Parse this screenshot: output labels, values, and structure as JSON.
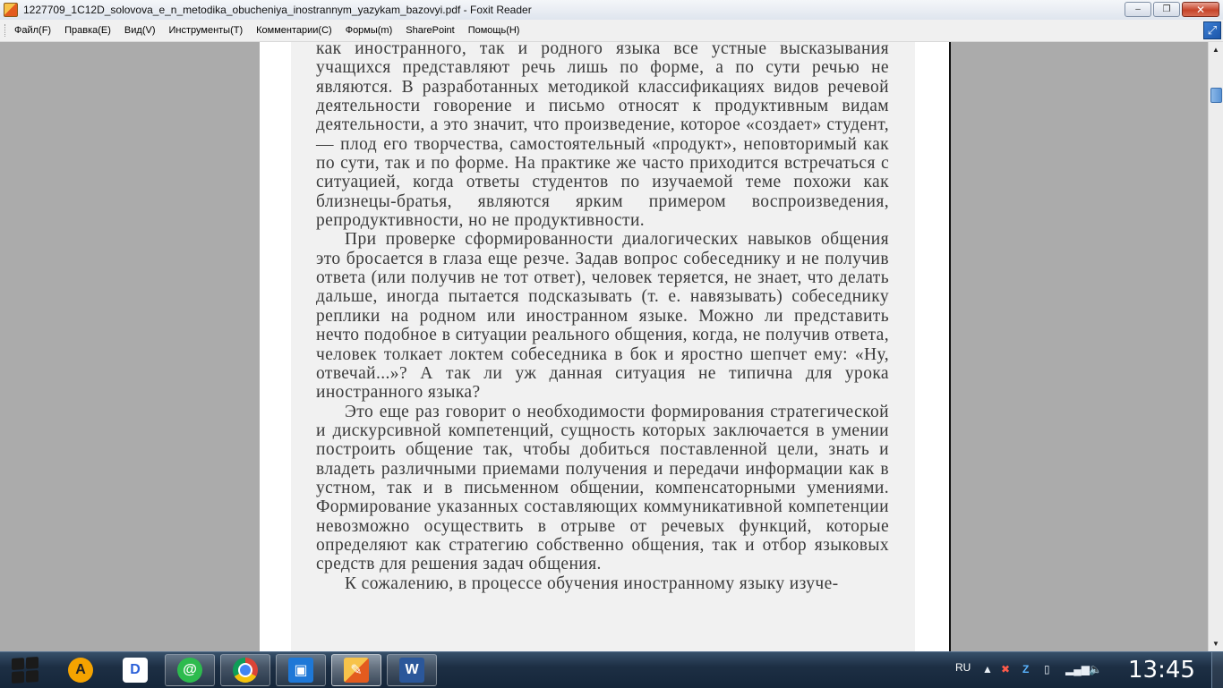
{
  "window": {
    "title": "1227709_1C12D_solovova_e_n_metodika_obucheniya_inostrannym_yazykam_bazovyi.pdf - Foxit Reader",
    "minimize": "‒",
    "maximize": "❐",
    "close": "✕"
  },
  "menu": {
    "items": [
      {
        "label": "Файл(F)"
      },
      {
        "label": "Правка(E)"
      },
      {
        "label": "Вид(V)"
      },
      {
        "label": "Инструменты(T)"
      },
      {
        "label": "Комментарии(C)"
      },
      {
        "label": "Формы(m)"
      },
      {
        "label": "SharePoint"
      },
      {
        "label": "Помощь(H)"
      }
    ]
  },
  "document": {
    "paragraphs": [
      {
        "text": "как иностранного, так и родного языка все устные высказывания учащихся представляют речь лишь по форме, а по сути речью не являются. В разработанных методикой классификациях видов речевой деятельности говорение и письмо относят к продуктивным видам деятельности, а это значит, что произведение, которое «создает» студент,— плод его творчества, самостоятельный «продукт», неповторимый как по сути, так и по форме. На практике же часто приходится встречаться с ситуацией, когда ответы студентов по изучаемой теме похожи как близнецы-братья, являются ярким примером воспроизведения, репродуктивности, но не продуктивности.",
        "indent": false
      },
      {
        "text": "При проверке сформированности диалогических навыков общения это бросается в глаза еще резче. Задав вопрос собеседнику и не получив ответа (или получив не тот ответ), человек теряется, не знает, что делать дальше, иногда пытается подсказывать (т. е. навязывать) собеседнику реплики на родном или иностранном языке. Можно ли представить нечто подобное в ситуации реального общения, когда, не получив ответа, человек толкает локтем собеседника в бок и яростно шепчет ему: «Ну, отвечай...»? А так ли уж данная ситуация не типична для урока иностранного языка?",
        "indent": true
      },
      {
        "text": "Это еще раз говорит о необходимости формирования стратегической и дискурсивной компетенций, сущность которых заключается в умении построить общение так, чтобы добиться поставленной цели, знать и владеть различными приемами получения и передачи информации как в устном, так и в письменном общении, компенсаторными умениями. Формирование указанных составляющих коммуникативной компетенции невозможно осуществить в отрыве от речевых функций, которые определяют как стратегию собственно общения, так и отбор языковых средств для решения задач общения.",
        "indent": true
      },
      {
        "text": "К сожалению, в процессе обучения иностранному языку изуче-",
        "indent": true
      }
    ]
  },
  "scrollbar": {
    "up": "▲",
    "down": "▼"
  },
  "taskbar": {
    "apps": [
      {
        "name": "aimp-icon",
        "glyph": "A",
        "color": "#f5a300"
      },
      {
        "name": "dictionary-icon",
        "glyph": "D",
        "color": "#2a5fd8"
      },
      {
        "name": "mail-agent-icon",
        "glyph": "@",
        "color": "#2dbb4e"
      },
      {
        "name": "chrome-icon",
        "glyph": "◉",
        "color": "#d93a2b"
      },
      {
        "name": "virtualbox-icon",
        "glyph": "▣",
        "color": "#1e78d7"
      },
      {
        "name": "foxit-icon",
        "glyph": "✎",
        "color": "#f39a1e"
      },
      {
        "name": "word-icon",
        "glyph": "W",
        "color": "#2b579a"
      }
    ],
    "language": "RU",
    "clock": "13:45"
  }
}
